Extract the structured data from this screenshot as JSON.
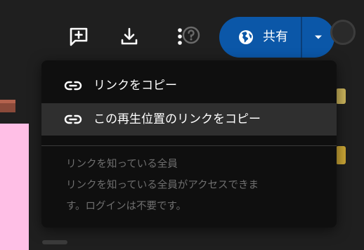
{
  "toolbar": {
    "icons": {
      "add_comment": "add-comment-icon",
      "download": "download-icon",
      "more": "more-vert-icon",
      "help": "help-icon"
    }
  },
  "share": {
    "label": "共有",
    "icon": "globe-icon",
    "caret_icon": "caret-down-icon",
    "color": "#0b57a8"
  },
  "menu": {
    "items": [
      {
        "label": "リンクをコピー",
        "icon": "link-icon"
      },
      {
        "label": "この再生位置のリンクをコピー",
        "icon": "link-icon"
      }
    ],
    "info": {
      "title": "リンクを知っている全員",
      "description_line1": "リンクを知っている全員がアクセスできま",
      "description_line2": "す。ログインは不要です。"
    }
  }
}
